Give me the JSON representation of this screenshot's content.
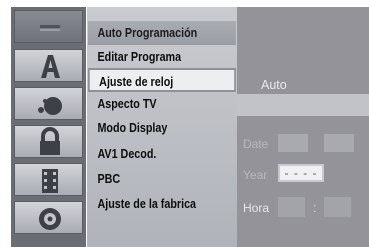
{
  "menu": {
    "items": [
      {
        "label": "Auto Programación"
      },
      {
        "label": "Editar Programa"
      },
      {
        "label": "Ajuste de reloj"
      },
      {
        "label": "Aspecto TV"
      },
      {
        "label": "Modo Display"
      },
      {
        "label": "AV1 Decod."
      },
      {
        "label": "PBC"
      },
      {
        "label": "Ajuste de la fabrica"
      }
    ],
    "selected_index": 2
  },
  "settings": {
    "value": "Auto",
    "date_label": "Date",
    "year_label": "Year",
    "year_value": "- - - -",
    "hora_label": "Hora",
    "time_separator": ":"
  },
  "icons": [
    {
      "name": "general-menu-icon"
    },
    {
      "name": "language-a-icon"
    },
    {
      "name": "audio-icon"
    },
    {
      "name": "lock-icon"
    },
    {
      "name": "film-icon"
    },
    {
      "name": "disc-icon"
    }
  ],
  "colors": {
    "menu_background": "#b0b3b9",
    "selected_item": "#eceef0",
    "right_panel": "#939399",
    "icon_column": "#6a6d74"
  }
}
